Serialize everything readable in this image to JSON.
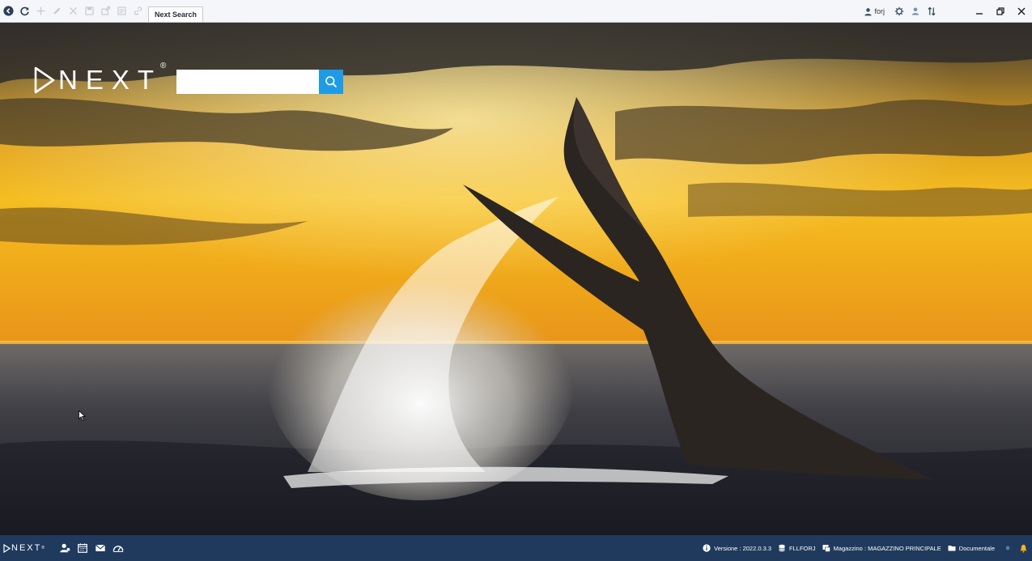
{
  "toolbar": {
    "buttons": [
      {
        "name": "back-icon",
        "enabled": true
      },
      {
        "name": "refresh-icon",
        "enabled": true
      },
      {
        "name": "add-icon",
        "enabled": false
      },
      {
        "name": "edit-icon",
        "enabled": false
      },
      {
        "name": "delete-icon",
        "enabled": false
      },
      {
        "name": "save-icon",
        "enabled": false
      },
      {
        "name": "export-icon",
        "enabled": false
      },
      {
        "name": "list-icon",
        "enabled": false
      },
      {
        "name": "link-icon",
        "enabled": false
      }
    ],
    "active_tab": "Next Search"
  },
  "user": {
    "name": "forj"
  },
  "top_right_icons": [
    "user-icon",
    "settings-icon",
    "users-icon",
    "sort-icon"
  ],
  "window_controls": [
    "minimize-icon",
    "restore-icon",
    "close-icon"
  ],
  "main": {
    "logo_text": "NEXT",
    "logo_reg": "®",
    "search_value": "",
    "search_button_icon": "search-icon"
  },
  "statusbar": {
    "logo_text": "NEXT",
    "logo_reg": "®",
    "left_icons": [
      "contacts-icon",
      "calendar-icon",
      "mail-icon",
      "dashboard-icon"
    ],
    "version": "Versione : 2022.0.3.3",
    "database": "FLLFORJ",
    "warehouse": "Magazzino : MAGAZZINO PRINCIPALE",
    "documents": "Documentale",
    "notification_icon": "bell-icon"
  },
  "colors": {
    "toolbar_bg": "#f4f6f9",
    "statusbar_bg": "#1f3a5c",
    "search_button": "#1e9be6",
    "sky_gold": "#f2b21e"
  }
}
